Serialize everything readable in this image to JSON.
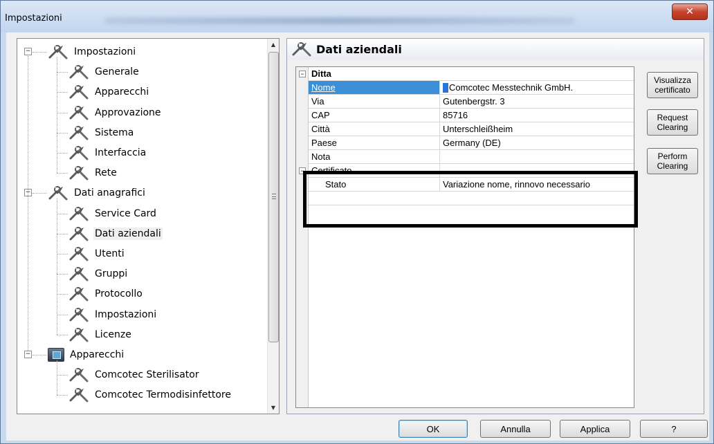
{
  "window": {
    "title": "Impostazioni",
    "close_glyph": "✕"
  },
  "tree": {
    "items": [
      {
        "label": "Impostazioni",
        "level": 0,
        "icon": "tools-icon",
        "expanded": true
      },
      {
        "label": "Generale",
        "level": 1,
        "icon": "tools-icon"
      },
      {
        "label": "Apparecchi",
        "level": 1,
        "icon": "tools-icon"
      },
      {
        "label": "Approvazione",
        "level": 1,
        "icon": "tools-icon"
      },
      {
        "label": "Sistema",
        "level": 1,
        "icon": "tools-icon"
      },
      {
        "label": "Interfaccia",
        "level": 1,
        "icon": "tools-icon"
      },
      {
        "label": "Rete",
        "level": 1,
        "icon": "tools-icon"
      },
      {
        "label": "Dati anagrafici",
        "level": 0,
        "icon": "tools-icon",
        "expanded": true
      },
      {
        "label": "Service Card",
        "level": 1,
        "icon": "tools-icon"
      },
      {
        "label": "Dati aziendali",
        "level": 1,
        "icon": "tools-icon",
        "selected": true
      },
      {
        "label": "Utenti",
        "level": 1,
        "icon": "tools-icon"
      },
      {
        "label": "Gruppi",
        "level": 1,
        "icon": "tools-icon"
      },
      {
        "label": "Protocollo",
        "level": 1,
        "icon": "tools-icon"
      },
      {
        "label": "Impostazioni",
        "level": 1,
        "icon": "tools-icon"
      },
      {
        "label": "Licenze",
        "level": 1,
        "icon": "tools-icon"
      },
      {
        "label": "Apparecchi",
        "level": 0,
        "icon": "device-icon",
        "expanded": true
      },
      {
        "label": "Comcotec Sterilisator",
        "level": 1,
        "icon": "tools-icon"
      },
      {
        "label": "Comcotec Termodisinfettore",
        "level": 1,
        "icon": "tools-icon"
      }
    ]
  },
  "panel": {
    "title": "Dati aziendali",
    "grid": {
      "category_ditta": "Ditta",
      "rows_ditta": [
        {
          "name": "Nome",
          "value": "Comcotec Messtechnik GmbH.",
          "selected": true
        },
        {
          "name": "Via",
          "value": "Gutenbergstr. 3"
        },
        {
          "name": "CAP",
          "value": "85716"
        },
        {
          "name": "Città",
          "value": "Unterschleißheim"
        },
        {
          "name": "Paese",
          "value": "Germany (DE)"
        },
        {
          "name": "Nota",
          "value": ""
        }
      ],
      "category_certificato": "Certificato",
      "row_stato": {
        "name": "Stato",
        "value": "Variazione nome, rinnovo necessario"
      },
      "toggle_glyph": "−"
    },
    "buttons": {
      "visualizza": "Visualizza certificato",
      "request": "Request Clearing",
      "perform": "Perform Clearing"
    }
  },
  "footer": {
    "ok": "OK",
    "annulla": "Annulla",
    "applica": "Applica",
    "help": "?"
  }
}
